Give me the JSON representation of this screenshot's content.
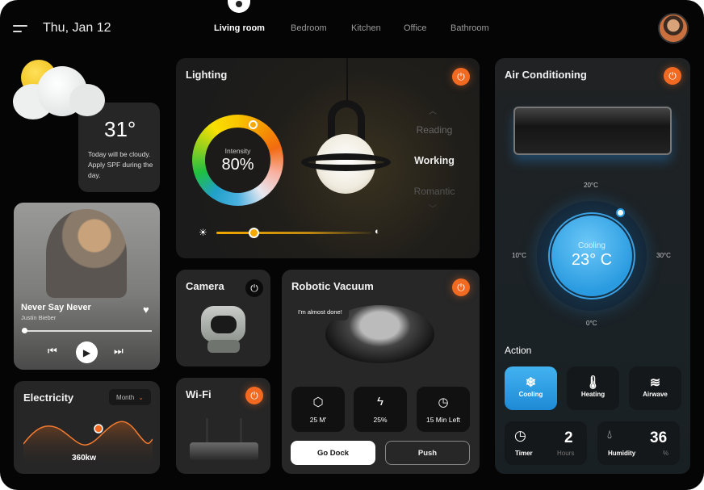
{
  "header": {
    "date": "Thu, Jan 12",
    "tabs": [
      "Living room",
      "Bedroom",
      "Kitchen",
      "Office",
      "Bathroom"
    ],
    "active_tab": "Living room"
  },
  "weather": {
    "temp": "31°",
    "text": "Today will be cloudy. Apply SPF during the day.",
    "icon": "partly-cloudy-icon"
  },
  "music": {
    "title": "Never Say Never",
    "artist": "Justin Bieber",
    "progress": 0.05
  },
  "electricity": {
    "title": "Electricity",
    "period": "Month",
    "value": "360kw"
  },
  "lighting": {
    "title": "Lighting",
    "intensity_label": "Intensity",
    "intensity": "80%",
    "modes": [
      "Reading",
      "Working",
      "Romantic"
    ],
    "active_mode": "Working",
    "brightness": 0.24
  },
  "camera": {
    "title": "Camera"
  },
  "wifi": {
    "title": "Wi-Fi"
  },
  "vacuum": {
    "title": "Robotic Vacuum",
    "message": "I'm almost done!",
    "stats": [
      {
        "icon": "cube-icon",
        "value": "25 M'"
      },
      {
        "icon": "bolt-icon",
        "value": "25%"
      },
      {
        "icon": "clock-icon",
        "value": "15 Min Left"
      }
    ],
    "go_dock": "Go Dock",
    "push": "Push"
  },
  "ac": {
    "title": "Air Conditioning",
    "mode": "Cooling",
    "temp": "23° C",
    "scale": {
      "top": "20°C",
      "left": "10°C",
      "right": "30°C",
      "bottom": "0°C"
    },
    "action_title": "Action",
    "actions": [
      {
        "label": "Cooling",
        "icon": "snowflake-icon",
        "active": true
      },
      {
        "label": "Heating",
        "icon": "thermometer-icon"
      },
      {
        "label": "Airwave",
        "icon": "wind-icon"
      }
    ],
    "timer": {
      "label": "Timer",
      "value": "2",
      "unit": "Hours"
    },
    "humidity": {
      "label": "Humidity",
      "value": "36",
      "unit": "%"
    }
  },
  "colors": {
    "accent": "#f26a21",
    "cool": "#2a9be0",
    "card": "#1d1d1e"
  }
}
